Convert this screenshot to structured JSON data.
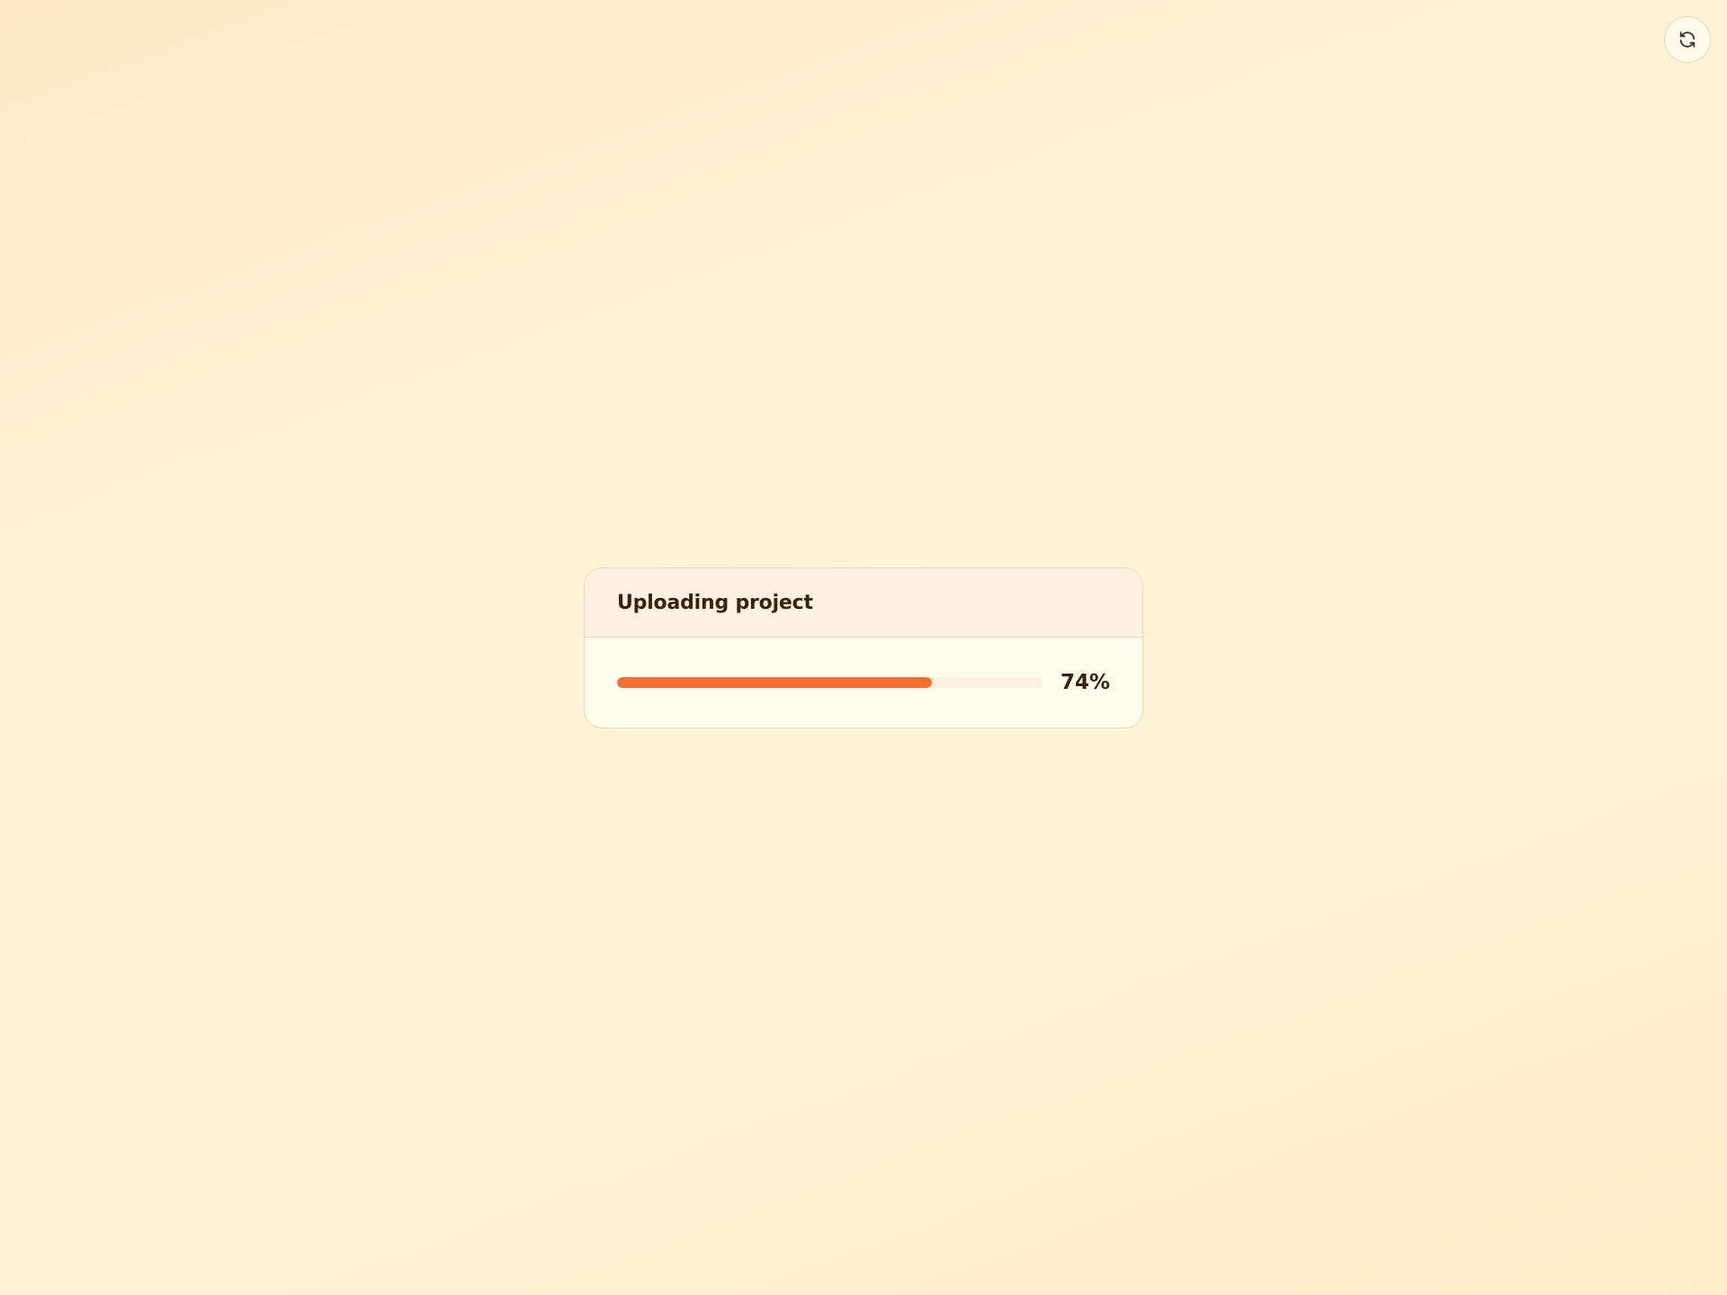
{
  "toolbar": {
    "refresh_icon": "refresh-icon"
  },
  "upload": {
    "title": "Uploading project",
    "progress_fraction": 0.74,
    "progress_label": "74%"
  },
  "colors": {
    "accent": "#f46e2e",
    "text": "#3a2210",
    "card_header_bg": "#fff1df",
    "card_bg": "#fffcee"
  }
}
